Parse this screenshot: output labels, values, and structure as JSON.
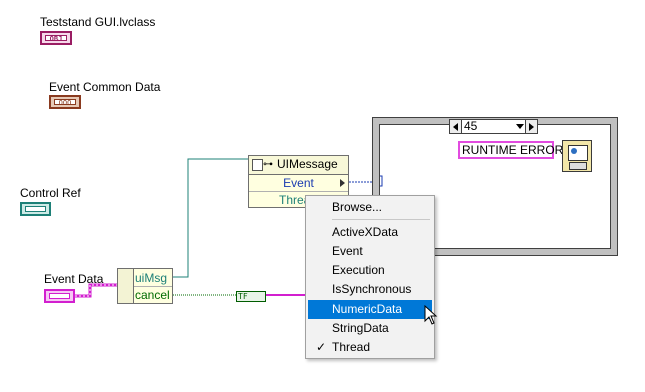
{
  "labels": {
    "teststand_class": "Teststand GUI.lvclass",
    "event_common_data": "Event Common Data",
    "control_ref": "Control Ref",
    "event_data": "Event Data"
  },
  "terminals": {
    "class_text": "OBJ",
    "common_text": "OOO",
    "event_text": "…"
  },
  "unbundle": {
    "row1": "uiMsg",
    "row2": "cancel"
  },
  "invoke_node": {
    "title": "UIMessage",
    "event_label": "Event",
    "thread_label": "Thread"
  },
  "case_structure": {
    "selector_value": "45",
    "string_constant": "RUNTIME ERROR"
  },
  "bool_constant": "TF",
  "context_menu": {
    "items": [
      {
        "label": "Browse..."
      },
      {
        "label": "ActiveXData"
      },
      {
        "label": "Event"
      },
      {
        "label": "Execution"
      },
      {
        "label": "IsSynchronous"
      },
      {
        "label": "NumericData"
      },
      {
        "label": "StringData"
      },
      {
        "label": "Thread"
      }
    ],
    "highlighted": "NumericData",
    "checked": "Thread",
    "check_glyph": "✓"
  },
  "colors": {
    "refnum_wire": "#1d8077",
    "cluster_wire": "#d21fcf",
    "bool_wire": "#006b00",
    "class_wire": "#9a1d63",
    "highlight": "#0078d7"
  }
}
